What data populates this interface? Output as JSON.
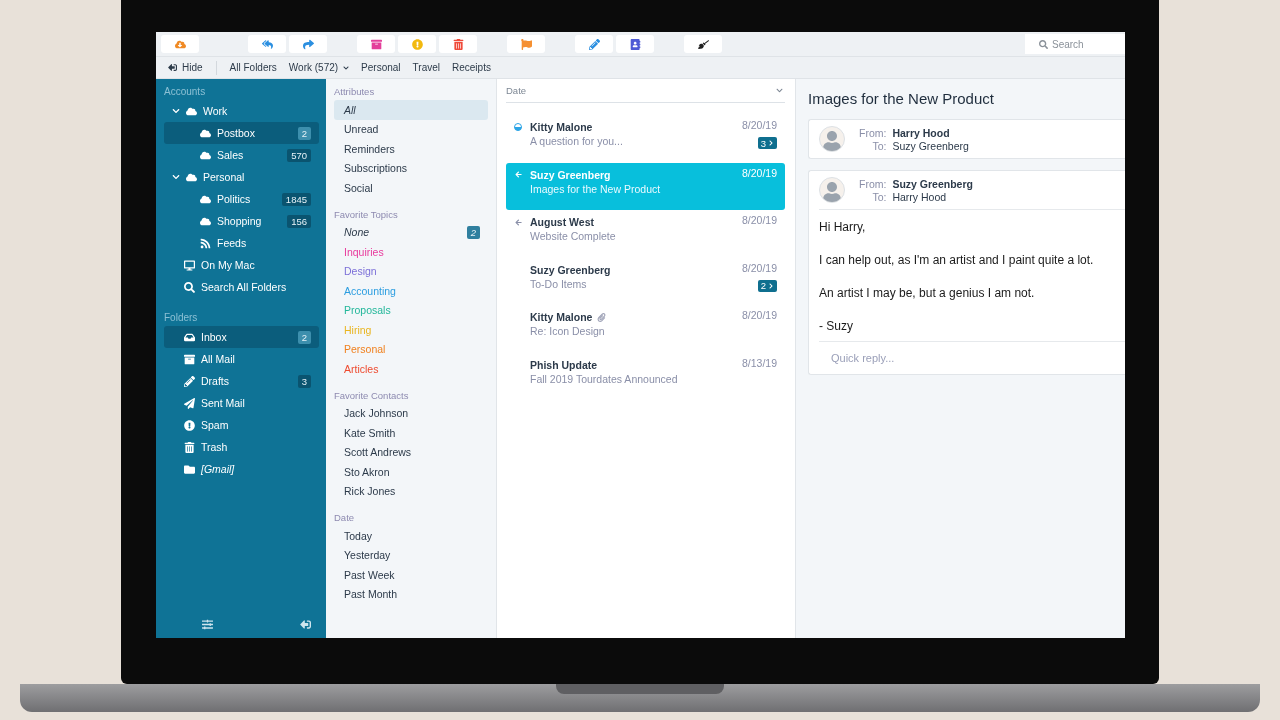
{
  "toolbar": {
    "search": {
      "placeholder": "Search"
    }
  },
  "tabs_bar": {
    "hide": "Hide",
    "tabs": [
      {
        "label": "All Folders",
        "menu": false
      },
      {
        "label": "Work (572)",
        "menu": true
      },
      {
        "label": "Personal",
        "menu": false
      },
      {
        "label": "Travel",
        "menu": false
      },
      {
        "label": "Receipts",
        "menu": false
      }
    ]
  },
  "sidebar": {
    "sections": [
      {
        "title": "Accounts",
        "items": [
          {
            "label": "Work",
            "kind": "account",
            "expanded": true,
            "selected": false,
            "children": [
              {
                "label": "Postbox",
                "kind": "cloud",
                "selected": true,
                "count": "2"
              },
              {
                "label": "Sales",
                "kind": "cloud",
                "selected": false,
                "count": "570"
              }
            ]
          },
          {
            "label": "Personal",
            "kind": "account",
            "expanded": true,
            "selected": false,
            "children": [
              {
                "label": "Politics",
                "kind": "cloud",
                "selected": false,
                "count": "1845"
              },
              {
                "label": "Shopping",
                "kind": "cloud",
                "selected": false,
                "count": "156"
              },
              {
                "label": "Feeds",
                "kind": "feed",
                "selected": false
              }
            ]
          },
          {
            "label": "On My Mac",
            "kind": "computer",
            "selected": false
          },
          {
            "label": "Search All Folders",
            "kind": "search",
            "selected": false
          }
        ]
      },
      {
        "title": "Folders",
        "items": [
          {
            "label": "Inbox",
            "kind": "inbox",
            "selected": true,
            "count": "2"
          },
          {
            "label": "All Mail",
            "kind": "archive",
            "selected": false
          },
          {
            "label": "Drafts",
            "kind": "drafts",
            "selected": false,
            "count": "3"
          },
          {
            "label": "Sent Mail",
            "kind": "sent",
            "selected": false
          },
          {
            "label": "Spam",
            "kind": "spam",
            "selected": false
          },
          {
            "label": "Trash",
            "kind": "trash",
            "selected": false
          },
          {
            "label": "[Gmail]",
            "kind": "gmail",
            "selected": false
          }
        ]
      }
    ]
  },
  "filters": {
    "sections": [
      {
        "title": "Attributes",
        "items": [
          {
            "label": "All",
            "kind": "any",
            "selected": true
          },
          {
            "label": "Unread",
            "kind": "plain",
            "selected": false
          },
          {
            "label": "Reminders",
            "kind": "plain",
            "selected": false
          },
          {
            "label": "Subscriptions",
            "kind": "plain",
            "selected": false
          },
          {
            "label": "Social",
            "kind": "plain",
            "selected": false
          }
        ]
      },
      {
        "title": "Favorite Topics",
        "items": [
          {
            "label": "None",
            "kind": "any",
            "count": "2"
          },
          {
            "label": "Inquiries",
            "kind": "topic",
            "color": "#e83a9c"
          },
          {
            "label": "Design",
            "kind": "topic",
            "color": "#7c70d8"
          },
          {
            "label": "Accounting",
            "kind": "topic",
            "color": "#2b9de0"
          },
          {
            "label": "Proposals",
            "kind": "topic",
            "color": "#22b79a"
          },
          {
            "label": "Hiring",
            "kind": "topic",
            "color": "#e9b520"
          },
          {
            "label": "Personal",
            "kind": "topic",
            "color": "#f0801e"
          },
          {
            "label": "Articles",
            "kind": "topic",
            "color": "#ee4a2f"
          }
        ]
      },
      {
        "title": "Favorite Contacts",
        "items": [
          {
            "label": "Jack Johnson",
            "kind": "plain"
          },
          {
            "label": "Kate Smith",
            "kind": "plain"
          },
          {
            "label": "Scott Andrews",
            "kind": "plain"
          },
          {
            "label": "Sto Akron",
            "kind": "plain"
          },
          {
            "label": "Rick Jones",
            "kind": "plain"
          }
        ]
      },
      {
        "title": "Date",
        "items": [
          {
            "label": "Today",
            "kind": "plain"
          },
          {
            "label": "Yesterday",
            "kind": "plain"
          },
          {
            "label": "Past Week",
            "kind": "plain"
          },
          {
            "label": "Past Month",
            "kind": "plain"
          }
        ]
      }
    ]
  },
  "message_list": {
    "sort": "Date",
    "messages": [
      {
        "sender": "Kitty Malone",
        "subject": "A question for you...",
        "date": "8/20/19",
        "kind": "unread",
        "attachment": false,
        "thread_count": "3",
        "selected": false
      },
      {
        "sender": "Suzy Greenberg",
        "subject": "Images for the New Product",
        "date": "8/20/19",
        "kind": "replied",
        "attachment": false,
        "selected": true
      },
      {
        "sender": "August West",
        "subject": "Website Complete",
        "date": "8/20/19",
        "kind": "replied",
        "attachment": false,
        "selected": false
      },
      {
        "sender": "Suzy Greenberg",
        "subject": "To-Do Items",
        "date": "8/20/19",
        "kind": "plain",
        "attachment": false,
        "thread_count": "2",
        "selected": false
      },
      {
        "sender": "Kitty Malone",
        "subject": "Re: Icon Design",
        "date": "8/20/19",
        "kind": "plain",
        "attachment": true,
        "selected": false
      },
      {
        "sender": "Phish Update",
        "subject": "Fall 2019 Tourdates Announced",
        "date": "8/13/19",
        "kind": "plain",
        "attachment": false,
        "selected": false
      }
    ]
  },
  "reader": {
    "title": "Images for the New Product",
    "messages": [
      {
        "from_label": "From:",
        "from": "Harry Hood",
        "to_label": "To:",
        "to": "Suzy Greenberg"
      },
      {
        "from_label": "From:",
        "from": "Suzy Greenberg",
        "to_label": "To:",
        "to": "Harry Hood",
        "body": [
          "Hi Harry,",
          "I can help out, as I'm an artist and I paint quite a lot.",
          "An artist I may be, but a genius I am not.",
          "- Suzy"
        ],
        "reply": {
          "placeholder": "Quick reply..."
        }
      }
    ]
  }
}
